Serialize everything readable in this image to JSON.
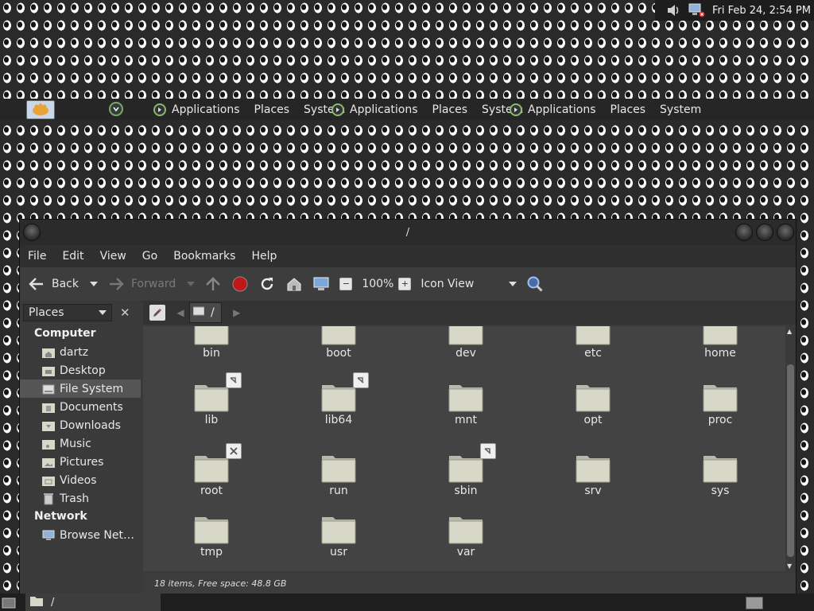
{
  "top_panel": {
    "clock": "Fri Feb 24,  2:54 PM",
    "icons": [
      "volume-icon",
      "network-icon"
    ]
  },
  "menu_panel": {
    "groups": [
      {
        "items": [
          "Applications",
          "Places",
          "System"
        ]
      },
      {
        "items": [
          "Applications",
          "Places",
          "System"
        ]
      },
      {
        "items": [
          "Applications",
          "Places",
          "System"
        ]
      }
    ]
  },
  "window": {
    "title": "/",
    "menu": [
      "File",
      "Edit",
      "View",
      "Go",
      "Bookmarks",
      "Help"
    ],
    "toolbar": {
      "back": "Back",
      "forward": "Forward",
      "zoom": "100%",
      "view_mode": "Icon View"
    },
    "sidebar": {
      "selector": "Places",
      "sections": [
        {
          "title": "Computer",
          "items": [
            "dartz",
            "Desktop",
            "File System",
            "Documents",
            "Downloads",
            "Music",
            "Pictures",
            "Videos",
            "Trash"
          ]
        },
        {
          "title": "Network",
          "items": [
            "Browse Net…"
          ]
        }
      ],
      "selected": "File System"
    },
    "location": {
      "path": "/"
    },
    "files": [
      {
        "name": "bin"
      },
      {
        "name": "boot"
      },
      {
        "name": "dev"
      },
      {
        "name": "etc"
      },
      {
        "name": "home"
      },
      {
        "name": "lib",
        "emblem": "symlink"
      },
      {
        "name": "lib64",
        "emblem": "symlink"
      },
      {
        "name": "mnt"
      },
      {
        "name": "opt"
      },
      {
        "name": "proc"
      },
      {
        "name": "root",
        "emblem": "no-access"
      },
      {
        "name": "run"
      },
      {
        "name": "sbin",
        "emblem": "symlink"
      },
      {
        "name": "srv"
      },
      {
        "name": "sys"
      },
      {
        "name": "tmp"
      },
      {
        "name": "usr"
      },
      {
        "name": "var"
      }
    ],
    "status": "18 items, Free space: 48.8 GB"
  },
  "bottom_panel": {
    "task": "/"
  },
  "colors": {
    "panel": "#1d1d1d",
    "window_bg": "#3a3a3a",
    "folder": "#d8d8c8",
    "accent_red": "#c01818"
  }
}
